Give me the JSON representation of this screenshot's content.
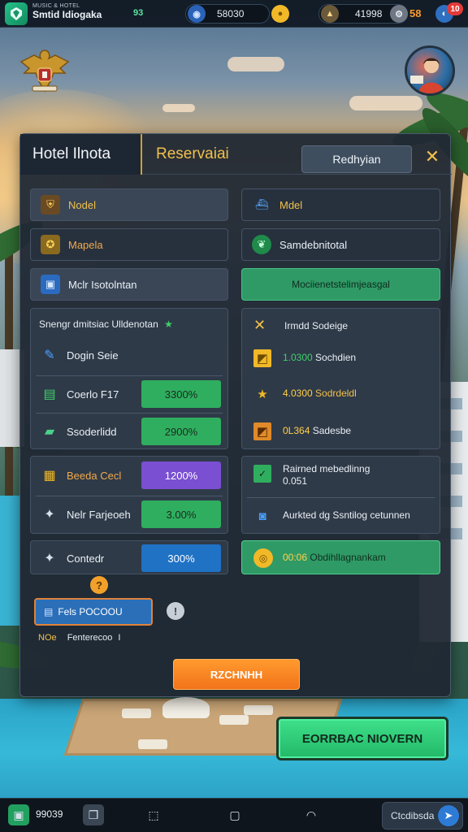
{
  "topbar": {
    "app_subtitle": "MUSIC & HOTEL",
    "app_title": "Smtid Idiogaka",
    "level": "93",
    "currency_a": "58030",
    "currency_b": "41998",
    "currency_c": "58",
    "notif_count": "10"
  },
  "panel": {
    "tab_hotel": "Hotel Ilnota",
    "tab_reservation": "Reservaiai",
    "head_button": "Redhyian",
    "left_rows": [
      {
        "icon": "shield-icon",
        "label": "Nodel"
      },
      {
        "icon": "badge-icon",
        "label": "Mapela"
      },
      {
        "icon": "camera-icon",
        "label": "Mclr Isotolntan"
      }
    ],
    "right_rows": [
      {
        "icon": "ship-icon",
        "label": "Mdel"
      },
      {
        "icon": "leaf-icon",
        "label": "Samdebnitotal"
      }
    ],
    "green_banner": "Mociienetstelimjeasgal",
    "stats_box": {
      "title": "Snengr dmitsiac Ulldenotan",
      "rows": [
        {
          "icon": "pencil-icon",
          "label": "Dogin Seie",
          "value": ""
        },
        {
          "icon": "money-icon",
          "label": "Coerlo F17",
          "value": "3300%"
        },
        {
          "icon": "book-icon",
          "label": "Ssoderlidd",
          "value": "2900%"
        }
      ]
    },
    "right_box": {
      "title": "Irmdd Sodeige",
      "rows": [
        {
          "icon": "check-icon",
          "num": "1.0300",
          "label": "Sochdien"
        },
        {
          "icon": "star-icon",
          "num": "4.0300",
          "label": "Sodrdeldl"
        },
        {
          "icon": "check-icon",
          "num": "0L364",
          "label": "Sadesbe"
        }
      ]
    },
    "mid_left_box": {
      "rows": [
        {
          "icon": "crate-icon",
          "label": "Beeda Cecl",
          "value": "1200%"
        },
        {
          "icon": "sparkle-icon",
          "label": "Nelr Farjeoeh",
          "value": "3.00%"
        }
      ]
    },
    "mid_right_box": {
      "line1": "Rairned mebedlinng",
      "line2": "0.051",
      "line3": "Aurkted dg Ssntilog cetunnen"
    },
    "bottom_left_row": {
      "icon": "sparkle-icon",
      "label": "Contedr",
      "value": "300%"
    },
    "bottom_right_row": {
      "icon": "coin-icon",
      "num": "00:06",
      "label": "Obdihllagnankam"
    },
    "promo_label": "Fels POCOOU",
    "promo_note_a": "NOe",
    "promo_note_b": "Fenterecoo",
    "promo_note_c": "I",
    "primary_button": "RZCHNHH"
  },
  "cta_button": "EORRBAC NIOVERN",
  "bottombar": {
    "count": "99039",
    "chat_label": "Ctcdibsda"
  },
  "colors": {
    "accent_gold": "#f1c04a",
    "green": "#2fae5f",
    "purple": "#7a4fd1",
    "blue": "#1f72c4",
    "orange": "#f2731a"
  }
}
